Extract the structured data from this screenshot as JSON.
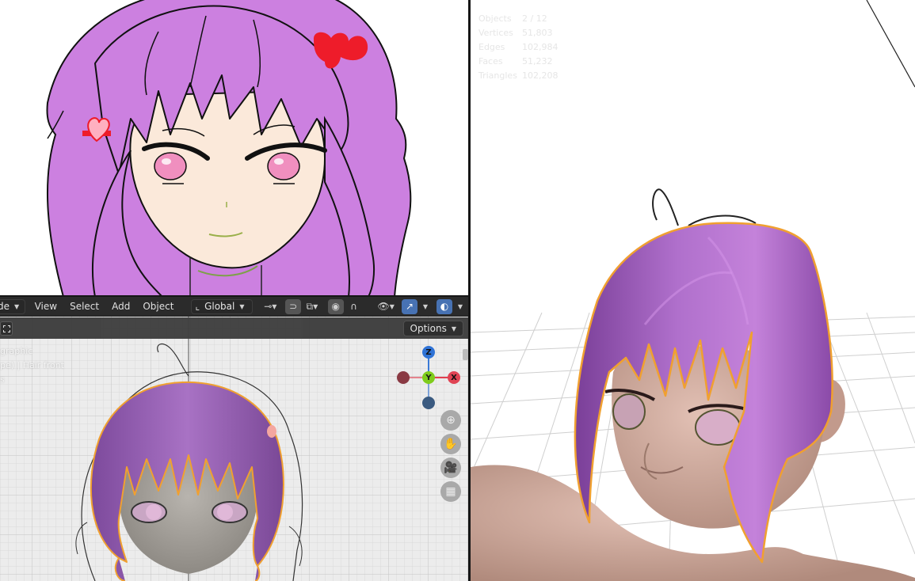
{
  "ortho_header": {
    "mode_label": "de",
    "menus": [
      "View",
      "Select",
      "Add",
      "Object"
    ],
    "orientation_label": "Global",
    "options_label": "Options"
  },
  "ortho_overlay": {
    "lines": [
      "graphic",
      "pe) | Hair front",
      "s"
    ]
  },
  "gizmo": {
    "z": "Z",
    "y": "Y",
    "x": "X"
  },
  "stats": {
    "rows": [
      {
        "label": "Objects",
        "value": "2 / 12"
      },
      {
        "label": "Vertices",
        "value": "51,803"
      },
      {
        "label": "Edges",
        "value": "102,984"
      },
      {
        "label": "Faces",
        "value": "51,232"
      },
      {
        "label": "Triangles",
        "value": "102,208"
      }
    ]
  },
  "colors": {
    "hair_purple": "#cc80e0",
    "hair_3d": "#9c5cc0",
    "skin_2d": "#fbe9da",
    "skin_3d": "#d2aea2",
    "selection_orange": "#f0a030",
    "header_bg": "#2b2b2b",
    "active_blue": "#4772b3"
  },
  "icons": {
    "orientation": "transform-axes-icon",
    "pivot": "pivot-icon",
    "snap": "magnet-icon",
    "proportional": "proportional-edit-icon",
    "visibility": "eye-icon",
    "gizmo_toggle": "gizmo-icon",
    "overlay_toggle": "overlay-icon"
  }
}
